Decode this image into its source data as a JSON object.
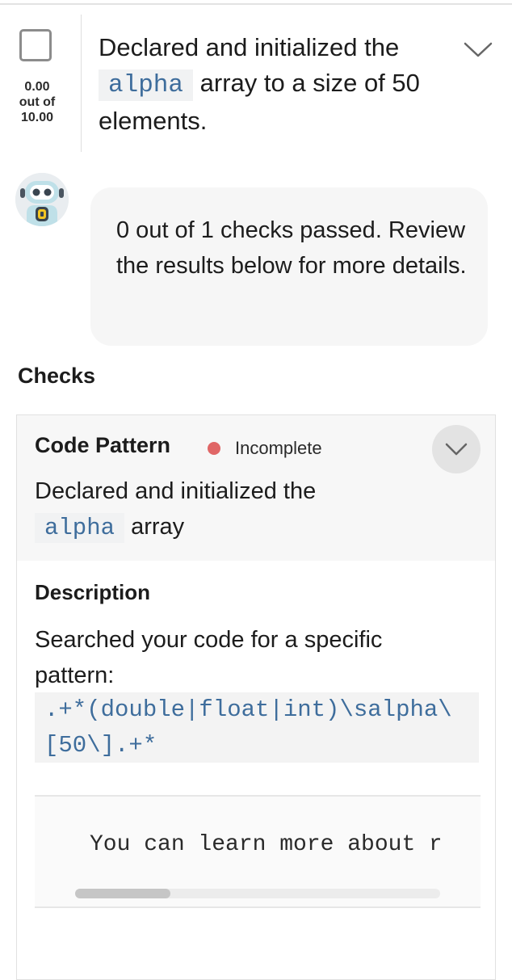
{
  "rubric": {
    "title_prefix": "Declared and initialized the",
    "title_code": "alpha",
    "title_suffix": "array to a size of 50 elements.",
    "score_value": "0.00",
    "score_out_of": "out of",
    "score_max": "10.00",
    "expand_icon": "chevron-down-icon"
  },
  "bot": {
    "avatar_icon": "robot-icon",
    "message": "0 out of 1 checks passed. Review the results below for more details."
  },
  "checks": {
    "heading": "Checks",
    "items": [
      {
        "type": "Code Pattern",
        "status": "Incomplete",
        "status_color": "#e06666",
        "title_prefix": "Declared and initialized the",
        "title_code": "alpha",
        "title_suffix": "array",
        "description_heading": "Description",
        "description_text": "Searched your code for a specific pattern:",
        "pattern": ".+*(double|float|int)\\salpha\\[50\\].+*",
        "learn_more": "You can learn more about regular expressions",
        "scroll_fraction": 0.26
      }
    ]
  }
}
